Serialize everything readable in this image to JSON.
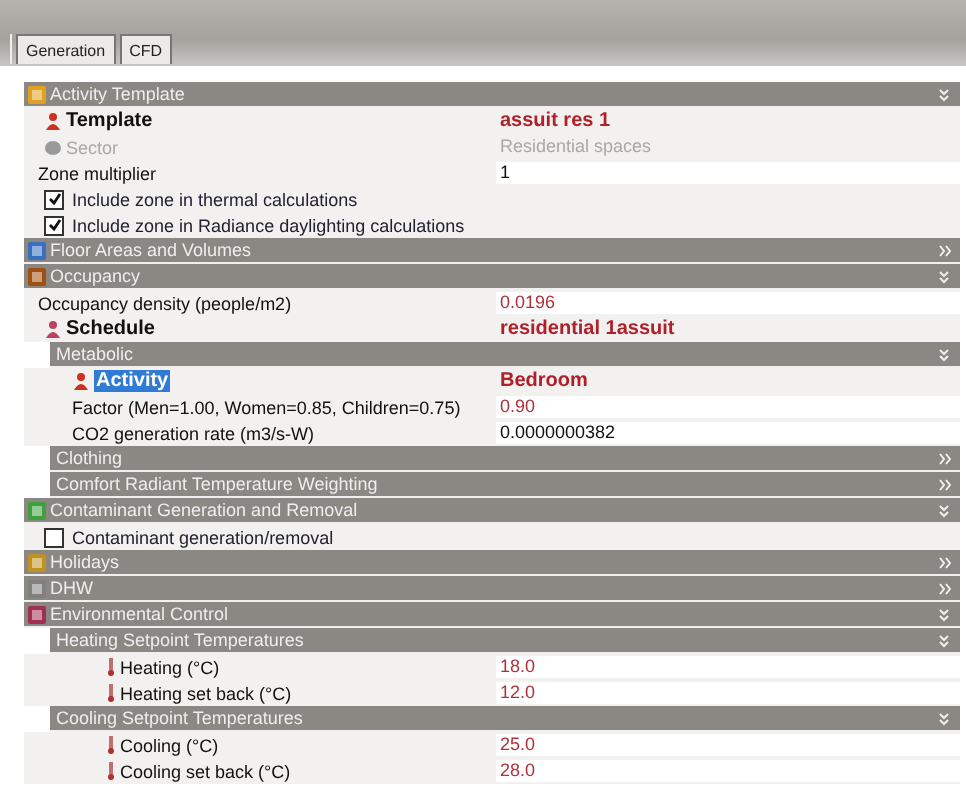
{
  "tabs": [
    {
      "label": "Generation",
      "selected": false
    },
    {
      "label": "CFD",
      "selected": false
    }
  ],
  "sections": [
    {
      "title": "Activity Template",
      "expanded": true,
      "rows": [
        {
          "kind": "link",
          "label": "Template",
          "value": "assuit res 1"
        },
        {
          "kind": "disabled",
          "label": "Sector",
          "value": "Residential spaces"
        },
        {
          "kind": "field",
          "label": "Zone multiplier",
          "value": "1",
          "default": true
        },
        {
          "kind": "checkbox",
          "label": "Include zone in thermal calculations",
          "checked": true
        },
        {
          "kind": "checkbox",
          "label": "Include zone in Radiance daylighting calculations",
          "checked": true
        }
      ]
    },
    {
      "title": "Floor Areas and Volumes",
      "expanded": false
    },
    {
      "title": "Occupancy",
      "expanded": true,
      "rows": [
        {
          "kind": "field",
          "label": "Occupancy density (people/m2)",
          "value": "0.0196",
          "default": false
        },
        {
          "kind": "link",
          "label": "Schedule",
          "value": "residential 1assuit"
        },
        {
          "kind": "group",
          "title": "Metabolic",
          "expanded": true,
          "rows": [
            {
              "kind": "link",
              "label": "Activity",
              "value": "Bedroom",
              "selected": true
            },
            {
              "kind": "field",
              "label": "Factor (Men=1.00, Women=0.85, Children=0.75)",
              "value": "0.90",
              "default": false
            },
            {
              "kind": "field",
              "label": "CO2 generation rate (m3/s-W)",
              "value": "0.0000000382",
              "default": true
            }
          ]
        },
        {
          "kind": "group",
          "title": "Clothing",
          "expanded": false
        },
        {
          "kind": "group",
          "title": "Comfort Radiant Temperature Weighting",
          "expanded": false
        }
      ]
    },
    {
      "title": "Contaminant Generation and Removal",
      "expanded": true,
      "rows": [
        {
          "kind": "checkbox",
          "label": "Contaminant generation/removal",
          "checked": false
        }
      ]
    },
    {
      "title": "Holidays",
      "expanded": false
    },
    {
      "title": "DHW",
      "expanded": false
    },
    {
      "title": "Environmental Control",
      "expanded": true,
      "rows": [
        {
          "kind": "group",
          "title": "Heating Setpoint Temperatures",
          "expanded": true,
          "rows": [
            {
              "kind": "setpoint",
              "label": "Heating (°C)",
              "value": "18.0"
            },
            {
              "kind": "setpoint",
              "label": "Heating set back (°C)",
              "value": "12.0"
            }
          ]
        },
        {
          "kind": "group",
          "title": "Cooling Setpoint Temperatures",
          "expanded": true,
          "rows": [
            {
              "kind": "setpoint",
              "label": "Cooling (°C)",
              "value": "25.0"
            },
            {
              "kind": "setpoint",
              "label": "Cooling set back (°C)",
              "value": "28.0"
            }
          ]
        }
      ]
    }
  ]
}
